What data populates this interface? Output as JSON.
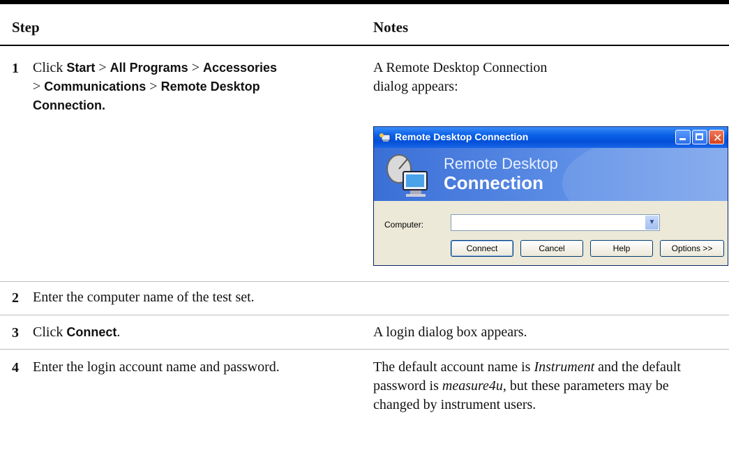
{
  "table": {
    "headers": {
      "step": "Step",
      "notes": "Notes"
    },
    "rows": [
      {
        "num": "1",
        "step": {
          "click": "Click",
          "start": "Start",
          "gt": ">",
          "all_programs": "All Programs",
          "accessories": "Accessories",
          "communications": "Communications",
          "rdc": "Remote Desktop",
          "connection": "Connection."
        },
        "notes": "A Remote Desktop Connection dialog appears:"
      },
      {
        "num": "2",
        "step": "Enter the computer name of the test set.",
        "notes": ""
      },
      {
        "num": "3",
        "step": {
          "click": "Click",
          "connect": "Connect",
          "period": "."
        },
        "notes": "A login dialog box appears."
      },
      {
        "num": "4",
        "step": "Enter the login account name and password.",
        "notes": {
          "p1": "The default account name is",
          "account": "Instrument",
          "p2": "and the default password is",
          "password": "measure4u",
          "p3": ", but these parameters may be changed by instrument users."
        }
      }
    ]
  },
  "dialog": {
    "title": "Remote Desktop Connection",
    "banner_line1": "Remote Desktop",
    "banner_line2": "Connection",
    "computer_label": "Computer:",
    "computer_value": "",
    "buttons": {
      "connect": "Connect",
      "cancel": "Cancel",
      "help": "Help",
      "options": "Options >>"
    },
    "icons": {
      "title": "remote-desktop-icon",
      "banner": "computer-satellite-icon",
      "minimize": "minimize-icon",
      "maximize": "maximize-icon",
      "close": "close-icon",
      "dropdown": "chevron-down-icon"
    }
  }
}
